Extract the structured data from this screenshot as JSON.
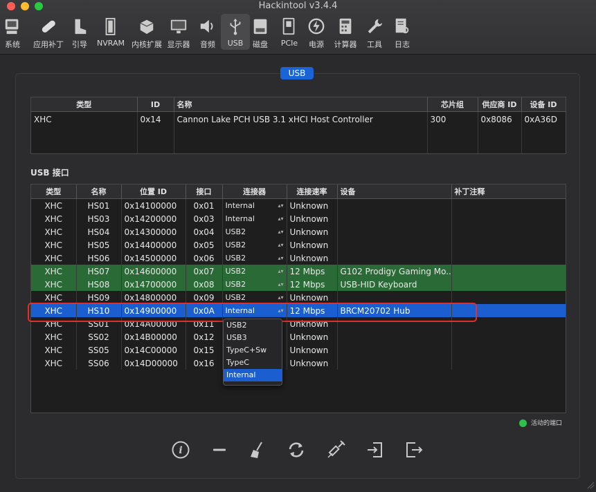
{
  "window": {
    "title": "Hackintool v3.4.4"
  },
  "tabs": [
    {
      "label": "系统",
      "icon": "system-icon"
    },
    {
      "label": "应用补丁",
      "icon": "bandage-icon"
    },
    {
      "label": "引导",
      "icon": "boot-icon"
    },
    {
      "label": "NVRAM",
      "icon": "nvram-icon"
    },
    {
      "label": "内核扩展",
      "icon": "kext-icon"
    },
    {
      "label": "显示器",
      "icon": "display-icon"
    },
    {
      "label": "音频",
      "icon": "audio-icon"
    },
    {
      "label": "USB",
      "icon": "usb-icon"
    },
    {
      "label": "磁盘",
      "icon": "disk-icon"
    },
    {
      "label": "PCIe",
      "icon": "pcie-icon"
    },
    {
      "label": "电源",
      "icon": "power-icon"
    },
    {
      "label": "计算器",
      "icon": "calculator-icon"
    },
    {
      "label": "工具",
      "icon": "wrench-icon"
    },
    {
      "label": "日志",
      "icon": "log-icon"
    }
  ],
  "active_tab": "USB",
  "section_badge": "USB",
  "controllers": {
    "headers": [
      "类型",
      "ID",
      "名称",
      "芯片组",
      "供应商 ID",
      "设备 ID"
    ],
    "rows": [
      {
        "type": "XHC",
        "id": "0x14",
        "name": "Cannon Lake PCH USB 3.1 xHCI Host Controller",
        "chipset": "300",
        "vendor_id": "0x8086",
        "device_id": "0xA36D"
      }
    ]
  },
  "ports_section_label": "USB 接口",
  "ports": {
    "headers": [
      "类型",
      "名称",
      "位置 ID",
      "接口",
      "连接器",
      "连接速率",
      "设备",
      "补丁注释"
    ],
    "rows": [
      {
        "type": "XHC",
        "name": "HS01",
        "location": "0x14100000",
        "port": "0x01",
        "connector": "Internal",
        "speed": "Unknown",
        "device": "",
        "comment": "",
        "state": "normal"
      },
      {
        "type": "XHC",
        "name": "HS03",
        "location": "0x14200000",
        "port": "0x03",
        "connector": "Internal",
        "speed": "Unknown",
        "device": "",
        "comment": "",
        "state": "normal"
      },
      {
        "type": "XHC",
        "name": "HS04",
        "location": "0x14300000",
        "port": "0x04",
        "connector": "USB2",
        "speed": "Unknown",
        "device": "",
        "comment": "",
        "state": "normal"
      },
      {
        "type": "XHC",
        "name": "HS05",
        "location": "0x14400000",
        "port": "0x05",
        "connector": "USB2",
        "speed": "Unknown",
        "device": "",
        "comment": "",
        "state": "normal"
      },
      {
        "type": "XHC",
        "name": "HS06",
        "location": "0x14500000",
        "port": "0x06",
        "connector": "USB2",
        "speed": "Unknown",
        "device": "",
        "comment": "",
        "state": "normal"
      },
      {
        "type": "XHC",
        "name": "HS07",
        "location": "0x14600000",
        "port": "0x07",
        "connector": "USB2",
        "speed": "12 Mbps",
        "device": "G102 Prodigy Gaming Mo...",
        "comment": "",
        "state": "active"
      },
      {
        "type": "XHC",
        "name": "HS08",
        "location": "0x14700000",
        "port": "0x08",
        "connector": "USB2",
        "speed": "12 Mbps",
        "device": "USB-HID Keyboard",
        "comment": "",
        "state": "active"
      },
      {
        "type": "XHC",
        "name": "HS09",
        "location": "0x14800000",
        "port": "0x09",
        "connector": "USB2",
        "speed": "Unknown",
        "device": "",
        "comment": "",
        "state": "normal"
      },
      {
        "type": "XHC",
        "name": "HS10",
        "location": "0x14900000",
        "port": "0x0A",
        "connector": "Internal",
        "speed": "12 Mbps",
        "device": "BRCM20702 Hub",
        "comment": "",
        "state": "selected"
      },
      {
        "type": "XHC",
        "name": "SS01",
        "location": "0x14A00000",
        "port": "0x11",
        "connector": "",
        "speed": "Unknown",
        "device": "",
        "comment": "",
        "state": "normal"
      },
      {
        "type": "XHC",
        "name": "SS02",
        "location": "0x14B00000",
        "port": "0x12",
        "connector": "",
        "speed": "Unknown",
        "device": "",
        "comment": "",
        "state": "normal"
      },
      {
        "type": "XHC",
        "name": "SS05",
        "location": "0x14C00000",
        "port": "0x15",
        "connector": "",
        "speed": "Unknown",
        "device": "",
        "comment": "",
        "state": "normal"
      },
      {
        "type": "XHC",
        "name": "SS06",
        "location": "0x14D00000",
        "port": "0x16",
        "connector": "",
        "speed": "Unknown",
        "device": "",
        "comment": "",
        "state": "normal"
      }
    ]
  },
  "connector_dropdown": {
    "options": [
      "USB2",
      "USB3",
      "TypeC+Sw",
      "TypeC",
      "Internal"
    ],
    "selected": "Internal"
  },
  "legend": {
    "label": "活动的端口",
    "color": "#2fc24b"
  },
  "bottom_toolbar": [
    "info-icon",
    "minus-icon",
    "broom-icon",
    "refresh-icon",
    "syringe-icon",
    "import-icon",
    "export-icon"
  ]
}
